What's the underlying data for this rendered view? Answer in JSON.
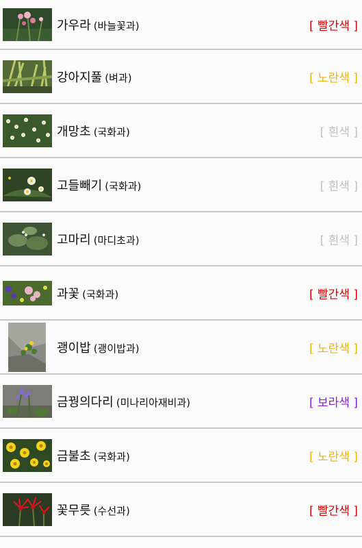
{
  "plants": [
    {
      "name": "가우라",
      "family": "(바늘꽃과)",
      "color_label": "[ 빨간색 ]",
      "color_hex": "#e00000",
      "thumb": "gaura-photo"
    },
    {
      "name": "강아지풀",
      "family": "(벼과)",
      "color_label": "[ 노란색 ]",
      "color_hex": "#f2b400",
      "thumb": "foxtail-photo"
    },
    {
      "name": "개망초",
      "family": "(국화과)",
      "color_label": "[ 흰색 ]",
      "color_hex": "#c0c0c0",
      "thumb": "fleabane-photo"
    },
    {
      "name": "고들빼기",
      "family": "(국화과)",
      "color_label": "[ 흰색 ]",
      "color_hex": "#c0c0c0",
      "thumb": "crepidiastrum-photo"
    },
    {
      "name": "고마리",
      "family": "(마디초과)",
      "color_label": "[ 흰색 ]",
      "color_hex": "#c0c0c0",
      "thumb": "knotweed-photo"
    },
    {
      "name": "과꽃",
      "family": "(국화과)",
      "color_label": "[ 빨간색 ]",
      "color_hex": "#e00000",
      "thumb": "aster-photo"
    },
    {
      "name": "괭이밥",
      "family": "(괭이밥과)",
      "color_label": "[ 노란색 ]",
      "color_hex": "#f2b400",
      "thumb": "woodsorrel-photo"
    },
    {
      "name": "금꿩의다리",
      "family": "(미나리아재비과)",
      "color_label": "[ 보라색 ]",
      "color_hex": "#8a1fd6",
      "thumb": "meadowrue-photo"
    },
    {
      "name": "금불초",
      "family": "(국화과)",
      "color_label": "[ 노란색 ]",
      "color_hex": "#f2b400",
      "thumb": "inula-photo"
    },
    {
      "name": "꽃무릇",
      "family": "(수선과)",
      "color_label": "[ 빨간색 ]",
      "color_hex": "#e00000",
      "thumb": "lycoris-photo"
    }
  ]
}
